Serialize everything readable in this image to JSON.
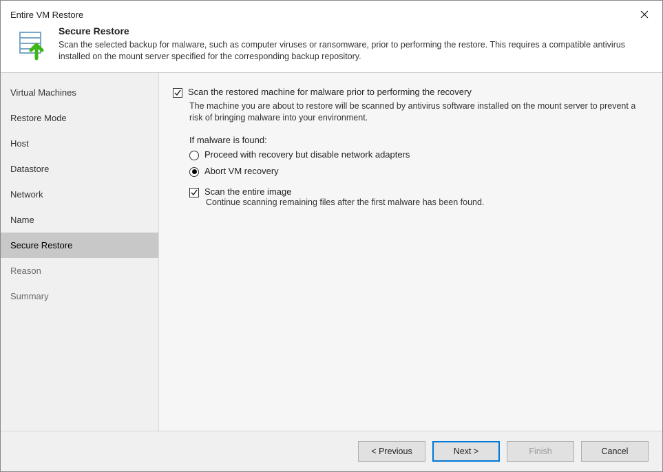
{
  "window": {
    "title": "Entire VM Restore"
  },
  "header": {
    "title": "Secure Restore",
    "description": "Scan the selected backup for malware, such as computer viruses or ransomware, prior to performing the restore. This requires a compatible antivirus installed on the mount server specified for the corresponding backup repository."
  },
  "sidebar": {
    "items": [
      {
        "label": "Virtual Machines"
      },
      {
        "label": "Restore Mode"
      },
      {
        "label": "Host"
      },
      {
        "label": "Datastore"
      },
      {
        "label": "Network"
      },
      {
        "label": "Name"
      },
      {
        "label": "Secure Restore"
      },
      {
        "label": "Reason"
      },
      {
        "label": "Summary"
      }
    ],
    "selectedIndex": 6
  },
  "content": {
    "scan_checkbox_label": "Scan the restored machine for malware prior to performing the recovery",
    "scan_checkbox_desc": "The machine you are about to restore will be scanned by antivirus software installed on the mount server to prevent a risk of bringing malware into your environment.",
    "malware_group_label": "If malware is found:",
    "radio_proceed_label": "Proceed with recovery but disable network adapters",
    "radio_abort_label": "Abort VM recovery",
    "scan_entire_label": "Scan the entire image",
    "scan_entire_desc": "Continue scanning remaining files after the first malware has been found."
  },
  "footer": {
    "previous": "< Previous",
    "next": "Next >",
    "finish": "Finish",
    "cancel": "Cancel"
  }
}
